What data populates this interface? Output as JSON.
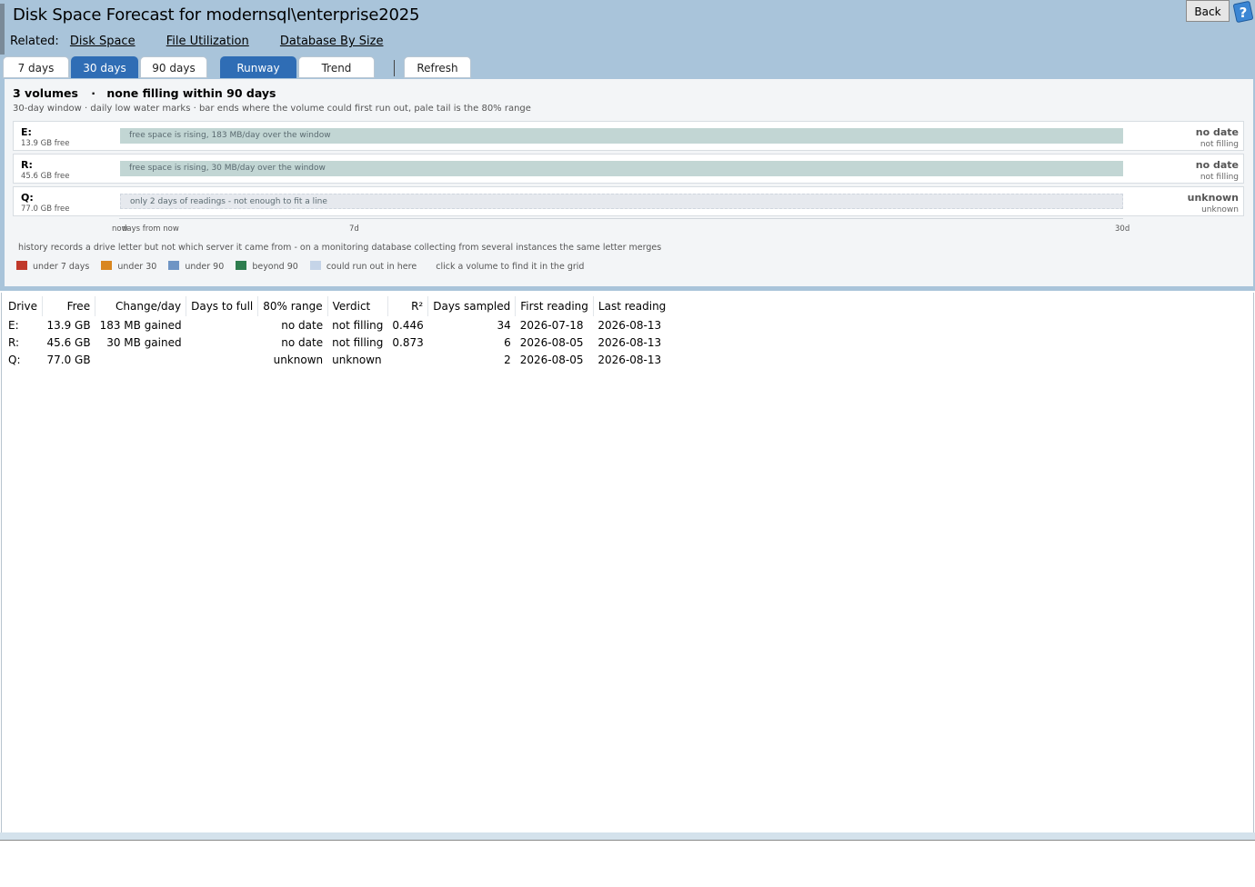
{
  "header": {
    "title": "Disk Space Forecast for modernsql\\enterprise2025",
    "back_label": "Back",
    "related_label": "Related:",
    "related_links": [
      "Disk Space",
      "File Utilization",
      "Database By Size"
    ]
  },
  "toolbar": {
    "range_tabs": [
      "7 days",
      "30 days",
      "90 days"
    ],
    "selected_range": "30 days",
    "view_tabs": [
      "Runway",
      "Trend"
    ],
    "selected_view": "Runway",
    "refresh_label": "Refresh"
  },
  "summary": {
    "count": "3 volumes",
    "dot": "·",
    "status": "none filling within 90 days",
    "subtitle": "30-day window · daily low water marks · bar ends where the volume could first run out, pale tail is the 80% range"
  },
  "volumes": [
    {
      "name": "E:",
      "free": "13.9 GB free",
      "bar_text": "free space is rising, 183 MB/day over the window",
      "date": "no date",
      "verdict": "not filling",
      "state": "rising"
    },
    {
      "name": "R:",
      "free": "45.6 GB free",
      "bar_text": "free space is rising, 30 MB/day over the window",
      "date": "no date",
      "verdict": "not filling",
      "state": "rising"
    },
    {
      "name": "Q:",
      "free": "77.0 GB free",
      "bar_text": "only 2 days of readings - not enough to fit a line",
      "date": "unknown",
      "verdict": "unknown",
      "state": "unknown"
    }
  ],
  "axis": {
    "start_label": "now",
    "title": "days from now",
    "mid_label": "7d",
    "end_label": "30d"
  },
  "note": "history records a drive letter but not which server it came from - on a monitoring database collecting from several instances the same letter merges",
  "legend": {
    "items": [
      {
        "label": "under 7 days",
        "color": "#c0392b"
      },
      {
        "label": "under 30",
        "color": "#d9861f"
      },
      {
        "label": "under 90",
        "color": "#6f95c4"
      },
      {
        "label": "beyond 90",
        "color": "#2e7d4f"
      },
      {
        "label": "could run out in here",
        "color": "#c5d4e8"
      }
    ],
    "hint": "click a volume to find it in the grid"
  },
  "colors": {
    "header_bg": "#a9c4da",
    "accent": "#2f6db5",
    "bar_rising": "#c2d6d4",
    "bar_unknown": "#e6e9ee"
  },
  "grid": {
    "columns": [
      "Drive",
      "Free",
      "Change/day",
      "Days to full",
      "80% range",
      "Verdict",
      "R²",
      "Days sampled",
      "First reading",
      "Last reading"
    ],
    "rows": [
      [
        "E:",
        "13.9 GB",
        "183 MB gained",
        "",
        "no date",
        "not filling",
        "0.446",
        "34",
        "2026-07-18",
        "2026-08-13"
      ],
      [
        "R:",
        "45.6 GB",
        "30 MB gained",
        "",
        "no date",
        "not filling",
        "0.873",
        "6",
        "2026-08-05",
        "2026-08-13"
      ],
      [
        "Q:",
        "77.0 GB",
        "",
        "",
        "unknown",
        "unknown",
        "",
        "2",
        "2026-08-05",
        "2026-08-13"
      ]
    ]
  }
}
